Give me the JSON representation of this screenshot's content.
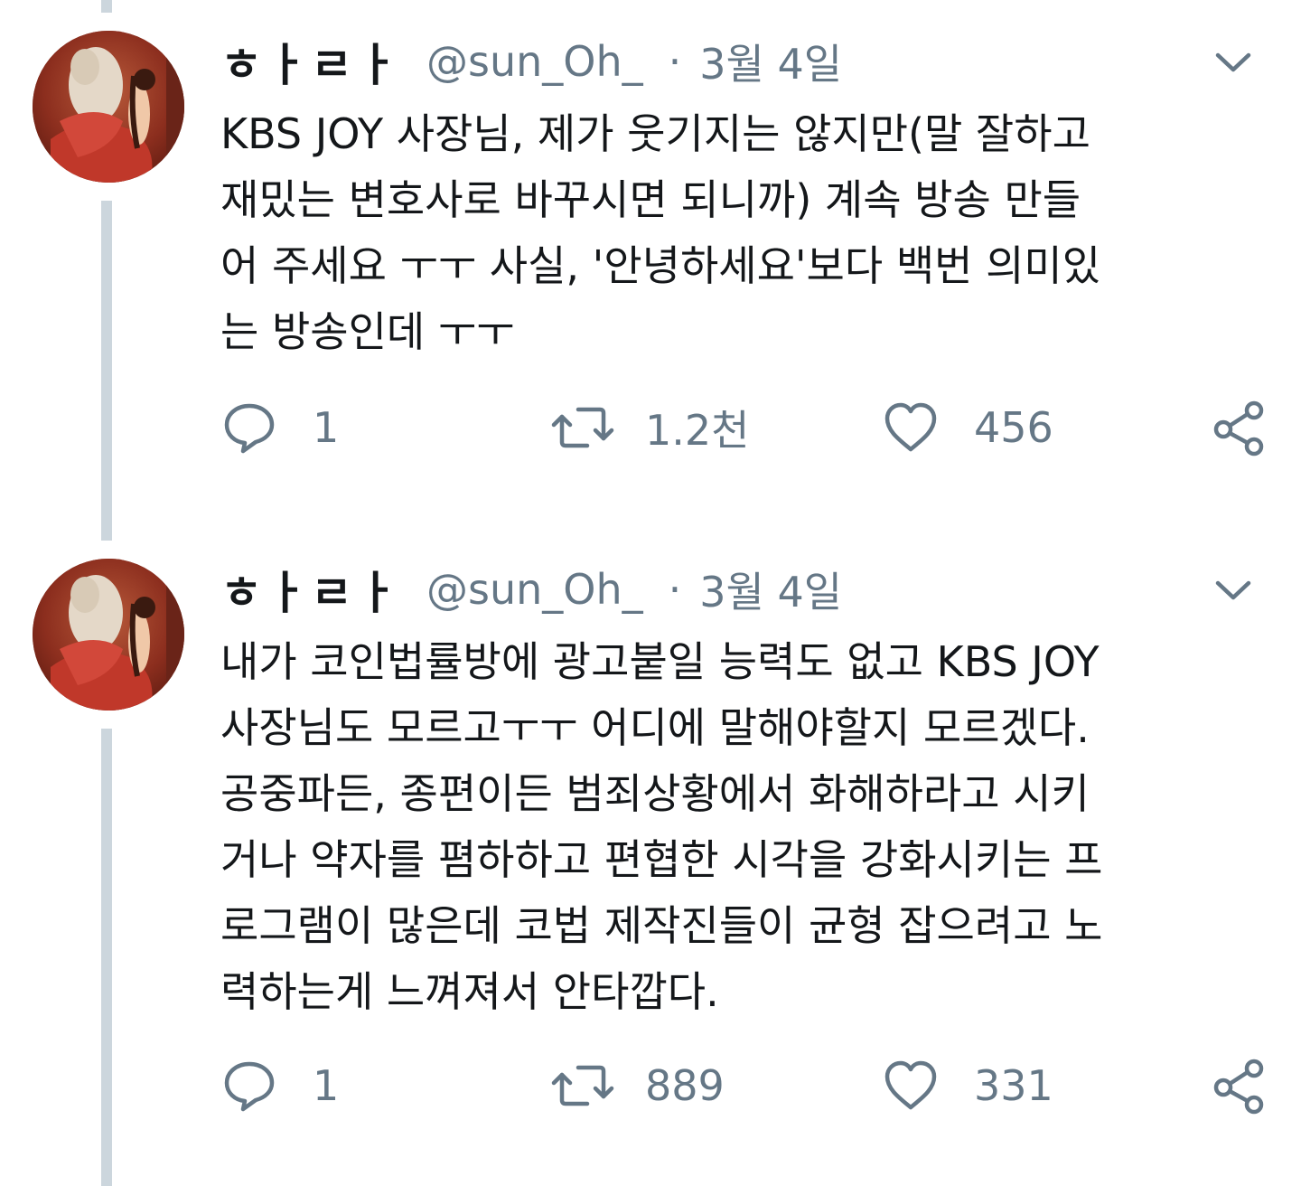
{
  "colors": {
    "text_primary": "#14171a",
    "text_secondary": "#657786",
    "thread_line": "#ccd6dd"
  },
  "tweets": [
    {
      "display_name": "ㅎㅏㄹㅏ",
      "handle": "@sun_Oh_",
      "separator": "·",
      "date": "3월 4일",
      "text_lines": [
        "KBS JOY 사장님, 제가 웃기지는 않지만(말 잘하고",
        "재밌는 변호사로 바꾸시면 되니까) 계속 방송 만들",
        "어 주세요 ㅜㅜ 사실, '안녕하세요'보다 백번 의미있",
        "는 방송인데 ㅜㅜ"
      ],
      "replies": "1",
      "retweets": "1.2천",
      "likes": "456",
      "icons": [
        "reply-icon",
        "retweet-icon",
        "like-icon",
        "share-icon",
        "chevron-down-icon"
      ]
    },
    {
      "display_name": "ㅎㅏㄹㅏ",
      "handle": "@sun_Oh_",
      "separator": "·",
      "date": "3월 4일",
      "text_lines": [
        "내가 코인법률방에 광고붙일 능력도 없고 KBS JOY",
        "사장님도 모르고ㅜㅜ 어디에 말해야할지 모르겠다.",
        "공중파든, 종편이든 범죄상황에서 화해하라고 시키",
        "거나 약자를 폄하하고 편협한 시각을 강화시키는 프",
        "로그램이 많은데 코법 제작진들이 균형 잡으려고 노",
        "력하는게 느껴져서 안타깝다."
      ],
      "replies": "1",
      "retweets": "889",
      "likes": "331",
      "icons": [
        "reply-icon",
        "retweet-icon",
        "like-icon",
        "share-icon",
        "chevron-down-icon"
      ]
    }
  ]
}
